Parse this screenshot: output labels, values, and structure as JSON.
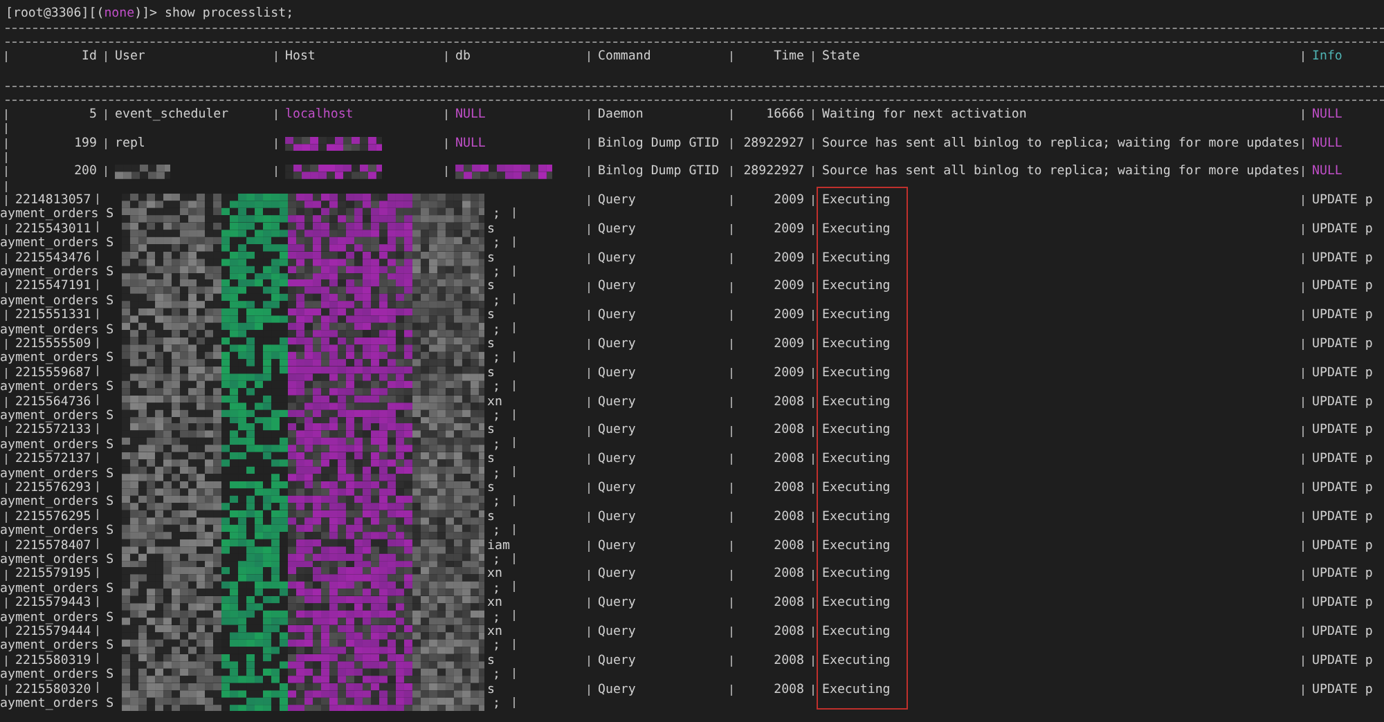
{
  "prompt": {
    "prefix": "[root@3306][(",
    "database": "none",
    "suffix": ")]>",
    "command": "show processlist;"
  },
  "columns": [
    {
      "label": "Id",
      "color": "#d0d0d0"
    },
    {
      "label": "User",
      "color": "#d0d0d0"
    },
    {
      "label": "Host",
      "color": "#d0d0d0"
    },
    {
      "label": "db",
      "color": "#d0d0d0"
    },
    {
      "label": "Command",
      "color": "#d0d0d0"
    },
    {
      "label": "Time",
      "color": "#d0d0d0"
    },
    {
      "label": "State",
      "color": "#d0d0d0"
    },
    {
      "label": "Info",
      "color": "#4fb3b3"
    }
  ],
  "rows": [
    {
      "kind": "plain",
      "cells": [
        {
          "text": "5",
          "highlighted": false
        },
        {
          "text": "event_scheduler",
          "highlighted": false
        },
        {
          "text": "localhost",
          "highlighted": true
        },
        {
          "text": "NULL",
          "highlighted": true
        },
        {
          "text": "Daemon",
          "highlighted": false
        },
        {
          "text": "16666",
          "highlighted": false
        },
        {
          "text": "Waiting for next activation",
          "highlighted": false
        },
        {
          "text": "NULL",
          "highlighted": true
        }
      ]
    },
    {
      "kind": "plain",
      "cells": [
        {
          "text": "199",
          "highlighted": false
        },
        {
          "text": "repl",
          "highlighted": false
        },
        {
          "redacted": true,
          "highlighted": true
        },
        {
          "text": "NULL",
          "highlighted": true
        },
        {
          "text": "Binlog Dump GTID",
          "highlighted": false
        },
        {
          "text": "28922927",
          "highlighted": false
        },
        {
          "text": "Source has sent all binlog to replica; waiting for more updates",
          "highlighted": false
        },
        {
          "text": "NULL",
          "highlighted": true
        }
      ]
    },
    {
      "kind": "plain",
      "cells": [
        {
          "text": "200",
          "highlighted": false
        },
        {
          "redacted": true,
          "highlighted": false
        },
        {
          "redacted": true,
          "highlighted": true
        },
        {
          "redacted": true,
          "highlighted": true
        },
        {
          "text": "Binlog Dump GTID",
          "highlighted": false
        },
        {
          "text": "28922927",
          "highlighted": false
        },
        {
          "text": "Source has sent all binlog to replica; waiting for more updates",
          "highlighted": false
        },
        {
          "text": "NULL",
          "highlighted": true
        }
      ]
    },
    {
      "kind": "wrapped",
      "id": "2214813057",
      "command": "Query",
      "time": "2009",
      "state": "Executing",
      "info": "UPDATE p",
      "wrap": "ayment_orders S",
      "wrap_tail": ";"
    },
    {
      "kind": "wrapped",
      "id": "2215543011",
      "db_tail": "s",
      "command": "Query",
      "time": "2009",
      "state": "Executing",
      "info": "UPDATE p",
      "wrap": "ayment_orders S",
      "wrap_tail": ";"
    },
    {
      "kind": "wrapped",
      "id": "2215543476",
      "db_tail": "s",
      "command": "Query",
      "time": "2009",
      "state": "Executing",
      "info": "UPDATE p",
      "wrap": "ayment_orders S",
      "wrap_tail": ";"
    },
    {
      "kind": "wrapped",
      "id": "2215547191",
      "db_tail": "s",
      "command": "Query",
      "time": "2009",
      "state": "Executing",
      "info": "UPDATE p",
      "wrap": "ayment_orders S",
      "wrap_tail": ";"
    },
    {
      "kind": "wrapped",
      "id": "2215551331",
      "db_tail": "s",
      "command": "Query",
      "time": "2009",
      "state": "Executing",
      "info": "UPDATE p",
      "wrap": "ayment_orders S",
      "wrap_tail": ";"
    },
    {
      "kind": "wrapped",
      "id": "2215555509",
      "db_tail": "s",
      "command": "Query",
      "time": "2009",
      "state": "Executing",
      "info": "UPDATE p",
      "wrap": "ayment_orders S",
      "wrap_tail": ";"
    },
    {
      "kind": "wrapped",
      "id": "2215559687",
      "db_tail": "s",
      "command": "Query",
      "time": "2009",
      "state": "Executing",
      "info": "UPDATE p",
      "wrap": "ayment_orders S",
      "wrap_tail": ";"
    },
    {
      "kind": "wrapped",
      "id": "2215564736",
      "db_tail": "xn",
      "command": "Query",
      "time": "2008",
      "state": "Executing",
      "info": "UPDATE p",
      "wrap": "ayment_orders S",
      "wrap_tail": ";"
    },
    {
      "kind": "wrapped",
      "id": "2215572133",
      "db_tail": "s",
      "command": "Query",
      "time": "2008",
      "state": "Executing",
      "info": "UPDATE p",
      "wrap": "ayment_orders S",
      "wrap_tail": ";"
    },
    {
      "kind": "wrapped",
      "id": "2215572137",
      "db_tail": "s",
      "command": "Query",
      "time": "2008",
      "state": "Executing",
      "info": "UPDATE p",
      "wrap": "ayment_orders S",
      "wrap_tail": ";"
    },
    {
      "kind": "wrapped",
      "id": "2215576293",
      "db_tail": "s",
      "command": "Query",
      "time": "2008",
      "state": "Executing",
      "info": "UPDATE p",
      "wrap": "ayment_orders S",
      "wrap_tail": ";"
    },
    {
      "kind": "wrapped",
      "id": "2215576295",
      "db_tail": "s",
      "command": "Query",
      "time": "2008",
      "state": "Executing",
      "info": "UPDATE p",
      "wrap": "ayment_orders S",
      "wrap_tail": ";"
    },
    {
      "kind": "wrapped",
      "id": "2215578407",
      "db_tail": "iam",
      "command": "Query",
      "time": "2008",
      "state": "Executing",
      "info": "UPDATE p",
      "wrap": "ayment_orders S",
      "wrap_tail": ";"
    },
    {
      "kind": "wrapped",
      "id": "2215579195",
      "db_tail": "xn",
      "command": "Query",
      "time": "2008",
      "state": "Executing",
      "info": "UPDATE p",
      "wrap": "ayment_orders S",
      "wrap_tail": ";"
    },
    {
      "kind": "wrapped",
      "id": "2215579443",
      "db_tail": "xn",
      "command": "Query",
      "time": "2008",
      "state": "Executing",
      "info": "UPDATE p",
      "wrap": "ayment_orders S",
      "wrap_tail": ";"
    },
    {
      "kind": "wrapped",
      "id": "2215579444",
      "db_tail": "xn",
      "command": "Query",
      "time": "2008",
      "state": "Executing",
      "info": "UPDATE p",
      "wrap": "ayment_orders S",
      "wrap_tail": ";"
    },
    {
      "kind": "wrapped",
      "id": "2215580319",
      "db_tail": "s",
      "command": "Query",
      "time": "2008",
      "state": "Executing",
      "info": "UPDATE p",
      "wrap": "ayment_orders S",
      "wrap_tail": ";"
    },
    {
      "kind": "wrapped",
      "id": "2215580320",
      "db_tail": "s",
      "command": "Query",
      "time": "2008",
      "state": "Executing",
      "info": "UPDATE p",
      "wrap": "ayment_orders S",
      "wrap_tail": ";"
    }
  ]
}
